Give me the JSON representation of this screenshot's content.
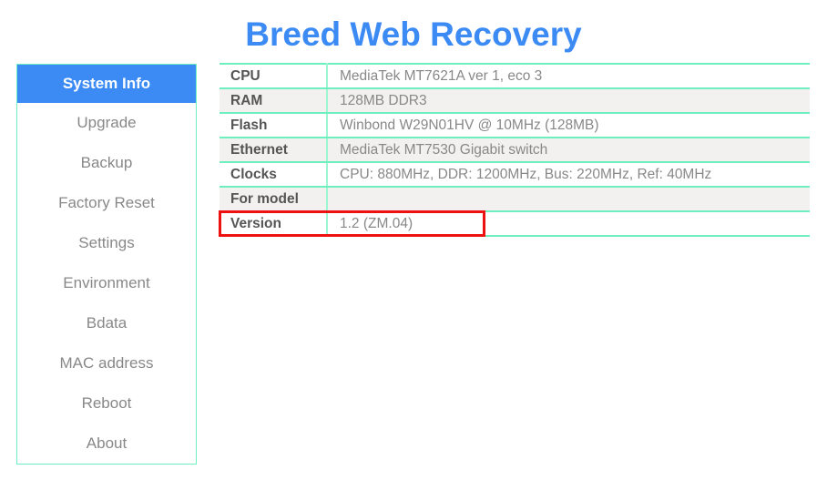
{
  "page": {
    "title": "Breed Web Recovery",
    "accent_blue": "#3c8bf5",
    "border_mint": "#6eefc0",
    "highlight_red": "#ee1111",
    "label_color": "#555555",
    "value_color": "#888888",
    "row_alt_bg": "#f2f1f0"
  },
  "sidebar": {
    "items": [
      {
        "label": "System Info",
        "active": true
      },
      {
        "label": "Upgrade",
        "active": false
      },
      {
        "label": "Backup",
        "active": false
      },
      {
        "label": "Factory Reset",
        "active": false
      },
      {
        "label": "Settings",
        "active": false
      },
      {
        "label": "Environment",
        "active": false
      },
      {
        "label": "Bdata",
        "active": false
      },
      {
        "label": "MAC address",
        "active": false
      },
      {
        "label": "Reboot",
        "active": false
      },
      {
        "label": "About",
        "active": false
      }
    ]
  },
  "system_info": {
    "rows": [
      {
        "key": "CPU",
        "value": "MediaTek MT7621A ver 1, eco 3"
      },
      {
        "key": "RAM",
        "value": "128MB DDR3"
      },
      {
        "key": "Flash",
        "value": "Winbond W29N01HV @ 10MHz (128MB)"
      },
      {
        "key": "Ethernet",
        "value": "MediaTek MT7530 Gigabit switch"
      },
      {
        "key": "Clocks",
        "value": "CPU: 880MHz, DDR: 1200MHz, Bus: 220MHz, Ref: 40MHz"
      },
      {
        "key": "For model",
        "value": ""
      },
      {
        "key": "Version",
        "value": "1.2 (ZM.04)",
        "highlighted": true
      }
    ]
  }
}
